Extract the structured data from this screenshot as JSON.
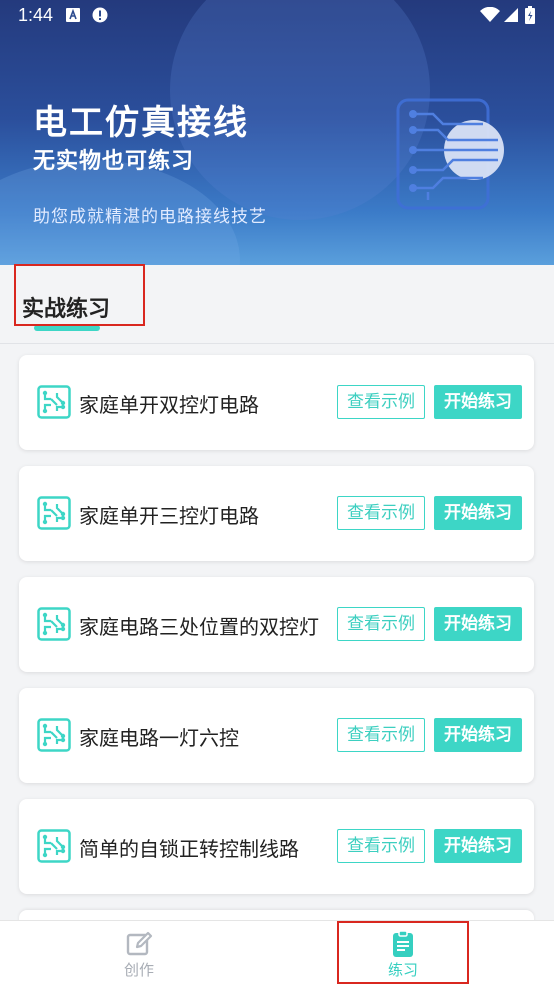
{
  "status_bar": {
    "time": "1:44"
  },
  "hero": {
    "title": "电工仿真接线",
    "subtitle": "无实物也可练习",
    "description": "助您成就精湛的电路接线技艺"
  },
  "section": {
    "title": "实战练习"
  },
  "cards": [
    {
      "title": "家庭单开双控灯电路",
      "view_label": "查看示例",
      "start_label": "开始练习"
    },
    {
      "title": "家庭单开三控灯电路",
      "view_label": "查看示例",
      "start_label": "开始练习"
    },
    {
      "title": "家庭电路三处位置的双控灯",
      "view_label": "查看示例",
      "start_label": "开始练习"
    },
    {
      "title": "家庭电路一灯六控",
      "view_label": "查看示例",
      "start_label": "开始练习"
    },
    {
      "title": "简单的自锁正转控制线路",
      "view_label": "查看示例",
      "start_label": "开始练习"
    }
  ],
  "bottom_nav": {
    "items": [
      {
        "label": "创作",
        "icon": "edit-icon",
        "active": false
      },
      {
        "label": "练习",
        "icon": "clipboard-icon",
        "active": true
      }
    ]
  },
  "colors": {
    "accent": "#3dd6c6",
    "hero_top": "#243a7d",
    "highlight": "#d9271f"
  }
}
